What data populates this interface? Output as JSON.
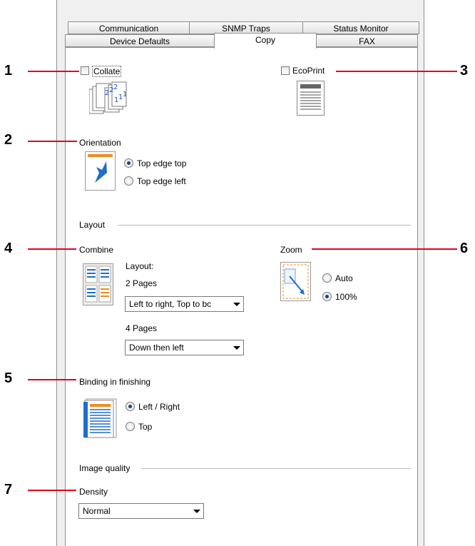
{
  "tabs": {
    "row1": [
      "Communication",
      "SNMP Traps",
      "Status Monitor"
    ],
    "row2": [
      "Device Defaults",
      "Copy",
      "FAX"
    ]
  },
  "collate": {
    "label": "Collate",
    "checked": false
  },
  "ecoprint": {
    "label": "EcoPrint",
    "checked": false
  },
  "orientation": {
    "title": "Orientation",
    "options": [
      "Top edge top",
      "Top edge left"
    ],
    "selected": 0
  },
  "layout_group": {
    "title": "Layout"
  },
  "combine": {
    "title": "Combine",
    "layout_label": "Layout:",
    "two_pages_label": "2 Pages",
    "two_pages_value": "Left to right, Top to bc",
    "four_pages_label": "4 Pages",
    "four_pages_value": "Down then left"
  },
  "zoom": {
    "title": "Zoom",
    "options": [
      "Auto",
      "100%"
    ],
    "selected": 1
  },
  "binding": {
    "title": "Binding in finishing",
    "options": [
      "Left / Right",
      "Top"
    ],
    "selected": 0
  },
  "image_quality": {
    "title": "Image quality",
    "density_label": "Density",
    "density_value": "Normal"
  },
  "callouts": [
    "1",
    "2",
    "3",
    "4",
    "5",
    "6",
    "7"
  ],
  "colors": {
    "callout": "#e3001b",
    "accent_blue": "#1e6ec8",
    "accent_orange": "#f08c1e"
  }
}
